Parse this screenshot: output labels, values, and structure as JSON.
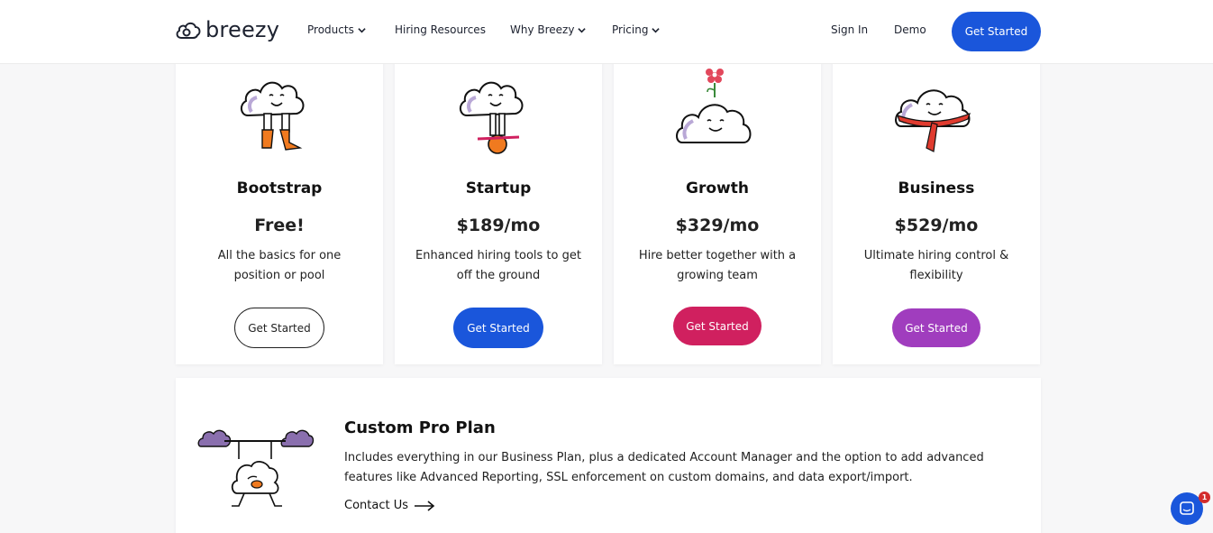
{
  "nav": {
    "logo_text": "breezy",
    "products": "Products",
    "hiring_resources": "Hiring Resources",
    "why_breezy": "Why Breezy",
    "pricing": "Pricing",
    "sign_in": "Sign In",
    "demo": "Demo",
    "get_started": "Get Started"
  },
  "plans": [
    {
      "name": "Bootstrap",
      "price": "Free!",
      "desc": "All the basics for one position or pool",
      "cta": "Get Started",
      "color": "#ffffff"
    },
    {
      "name": "Startup",
      "price": "$189/mo",
      "desc": "Enhanced hiring tools to get off the ground",
      "cta": "Get Started",
      "color": "#1a56db"
    },
    {
      "name": "Growth",
      "price": "$329/mo",
      "desc": "Hire better together with a growing team",
      "cta": "Get Started",
      "color": "#d0205f"
    },
    {
      "name": "Business",
      "price": "$529/mo",
      "desc": "Ultimate hiring control & flexibility",
      "cta": "Get Started",
      "color": "#a03dbe"
    }
  ],
  "custom_pro": {
    "title": "Custom Pro Plan",
    "desc": "Includes everything in our Business Plan, plus a dedicated Account Manager and the option to add advanced features like Advanced Reporting, SSL enforcement on custom domains, and data export/import.",
    "contact": "Contact Us"
  },
  "chat": {
    "badge": "1"
  },
  "colors": {
    "accent": "#1a56db",
    "growth": "#d0205f",
    "business": "#a03dbe"
  }
}
